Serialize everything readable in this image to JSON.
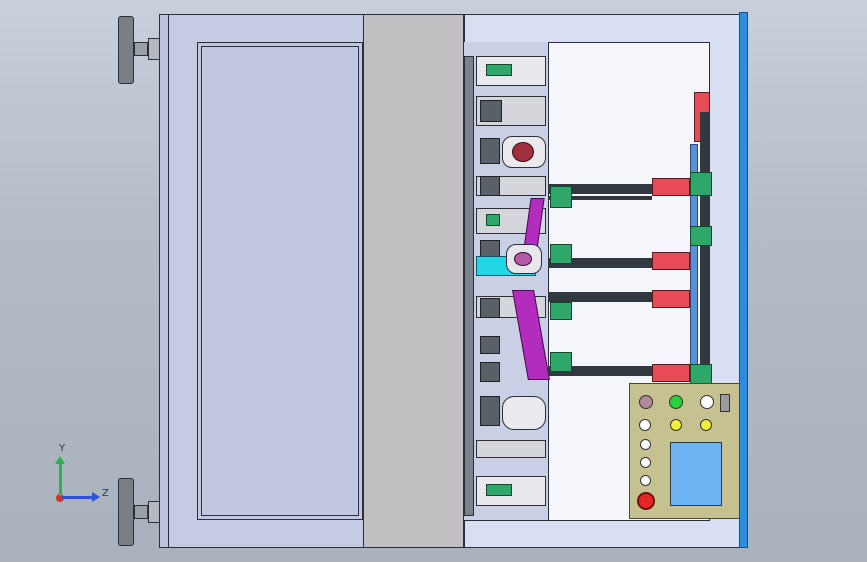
{
  "viewport": {
    "background_top": "#c8d0dc",
    "background_bottom": "#a9b1bd"
  },
  "triad": {
    "y_label": "Y",
    "z_label": "Z",
    "y_color": "#2fb04a",
    "z_color": "#2f52d6",
    "x_color": "#d62f2f"
  },
  "control_panel": {
    "screen_color": "#6fb4f2",
    "buttons": [
      {
        "name": "power",
        "color": "#b08a9a"
      },
      {
        "name": "green",
        "color": "#28d23a"
      },
      {
        "name": "white-1",
        "color": "#ffffff"
      },
      {
        "name": "white-2",
        "color": "#ffffff"
      },
      {
        "name": "yellow-1",
        "color": "#f4f035"
      },
      {
        "name": "yellow-2",
        "color": "#f4f035"
      },
      {
        "name": "white-3",
        "color": "#ffffff"
      },
      {
        "name": "white-4",
        "color": "#ffffff"
      },
      {
        "name": "white-5",
        "color": "#ffffff"
      },
      {
        "name": "white-6",
        "color": "#ffffff"
      },
      {
        "name": "emergency-stop",
        "color": "#e52727"
      }
    ]
  },
  "colors": {
    "frame": "#c5cbe3",
    "center_plate": "#c1bfc2",
    "door_panel": "#c2c8e2",
    "stripe": "#2b8fe0"
  }
}
